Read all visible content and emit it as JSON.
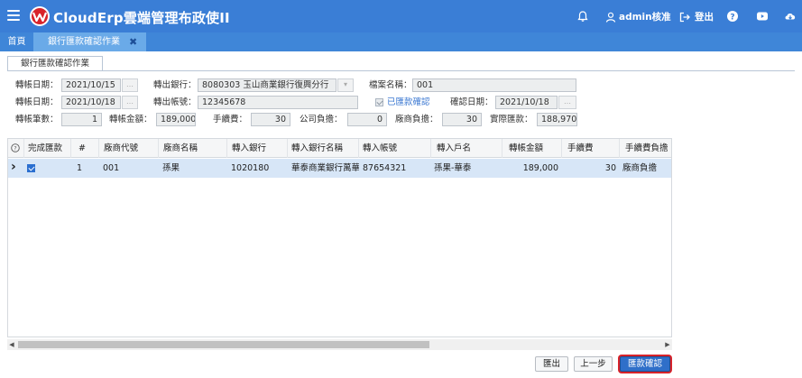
{
  "app": {
    "title": "CloudErp雲端管理布政使II",
    "user": "admin核准",
    "logout": "登出",
    "help_icon": "question-icon",
    "video_icon": "youtube-icon",
    "download_icon": "cloud-download-icon",
    "brand_color": "#3a7ed6"
  },
  "tabs": [
    {
      "label": "首頁"
    },
    {
      "label": "銀行匯款確認作業",
      "close": "✖"
    }
  ],
  "subtab": {
    "label": "銀行匯款確認作業"
  },
  "form": {
    "transfer_date_label": "轉帳日期：",
    "transfer_date_value": "2021/10/15",
    "out_bank_label": "轉出銀行：",
    "out_bank_value": "8080303 玉山商業銀行復興分行",
    "filename_label": "檔案名稱：",
    "filename_value": "001",
    "transfer_date2_label": "轉帳日期：",
    "transfer_date2_value": "2021/10/18",
    "out_account_label": "轉出帳號：",
    "out_account_value": "12345678",
    "remit_confirmed_label": "已匯款確認",
    "confirm_date_label": "確認日期：",
    "confirm_date_value": "2021/10/18",
    "count_label": "轉帳筆數：",
    "count_value": "1",
    "amount_label": "轉帳金額：",
    "amount_value": "189,000",
    "fee_label": "手續費：",
    "fee_value": "30",
    "company_burden_label": "公司負擔：",
    "company_burden_value": "0",
    "vendor_burden_label": "廠商負擔：",
    "vendor_burden_value": "30",
    "actual_remit_label": "實際匯款：",
    "actual_remit_value": "188,970"
  },
  "grid": {
    "columns": [
      "完成匯款",
      "#",
      "廠商代號",
      "廠商名稱",
      "轉入銀行",
      "轉入銀行名稱",
      "轉入帳號",
      "轉入戶名",
      "轉帳金額",
      "手續費",
      "手續費負擔"
    ],
    "help_icon": "?",
    "rows": [
      {
        "indicator": "›",
        "done": true,
        "index": "1",
        "vendor_code": "001",
        "vendor_name": "孫果",
        "in_bank": "1020180",
        "in_bank_name": "華泰商業銀行萬華",
        "in_account": "87654321",
        "in_name": "孫果-華泰",
        "amount": "189,000",
        "fee": "30",
        "fee_burden": "廠商負擔"
      }
    ]
  },
  "buttons": {
    "export": "匯出",
    "prev": "上一步",
    "confirm": "匯款確認"
  }
}
